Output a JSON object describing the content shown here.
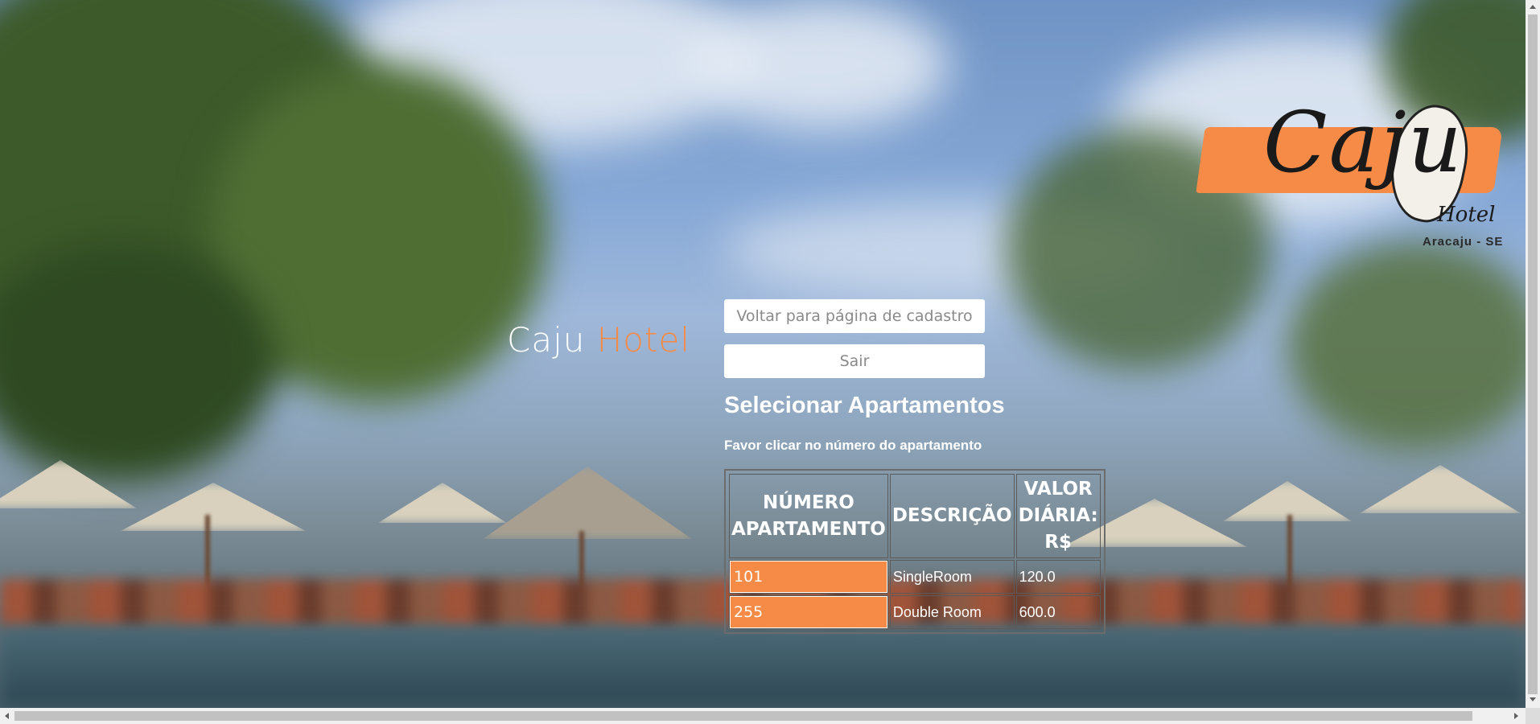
{
  "brand": {
    "name": "Caju",
    "name_accent": "Hotel"
  },
  "logo": {
    "word": "Caju",
    "subword": "Hotel",
    "city": "Aracaju - SE"
  },
  "nav": {
    "back_label": "Voltar para página de cadastro",
    "logout_label": "Sair"
  },
  "page": {
    "heading": "Selecionar Apartamentos",
    "instruction": "Favor clicar no número do apartamento"
  },
  "table": {
    "headers": [
      "NÚMERO APARTAMENTO",
      "DESCRIÇÃO",
      "VALOR DIÁRIA: R$"
    ],
    "rows": [
      {
        "number": "101",
        "description": "SingleRoom",
        "rate": "120.0"
      },
      {
        "number": "255",
        "description": "Double Room",
        "rate": "600.0"
      }
    ]
  },
  "colors": {
    "accent": "#f68b47",
    "text": "#ffffff",
    "button_bg": "#ffffff",
    "button_text": "#8a8a8a"
  }
}
